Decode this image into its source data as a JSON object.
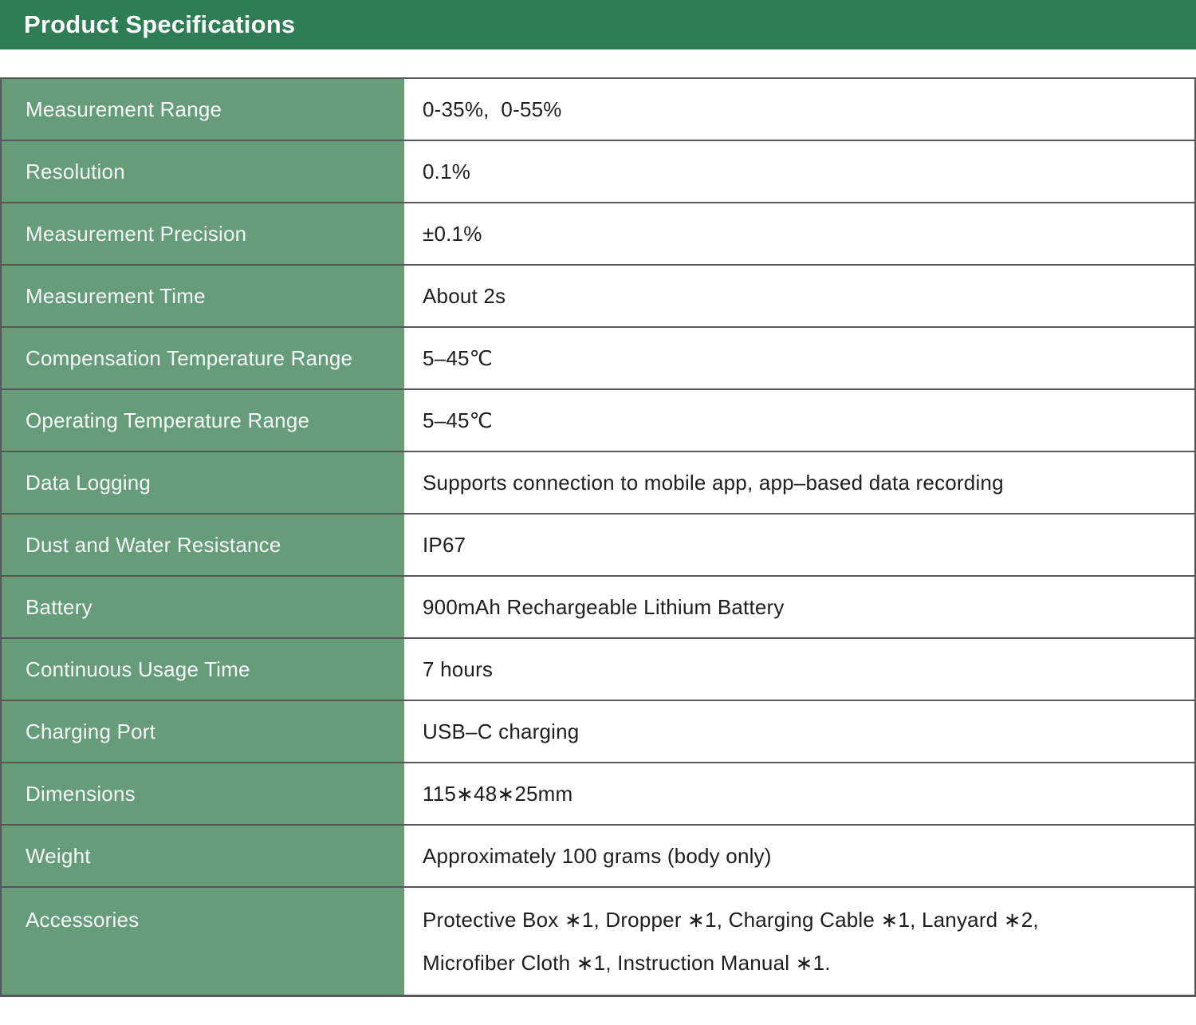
{
  "header": {
    "title": "Product Specifications"
  },
  "colors": {
    "header_green": "#2E7D55",
    "label_green": "#679C7B",
    "border_gray": "#565656",
    "value_text": "#1E1E1E",
    "label_text": "#F4F9F6"
  },
  "table": {
    "rows": [
      {
        "label": "Measurement Range",
        "value": "0-35%,  0-55%"
      },
      {
        "label": "Resolution",
        "value": "0.1%"
      },
      {
        "label": "Measurement Precision",
        "value": "±0.1%"
      },
      {
        "label": "Measurement Time",
        "value": "About 2s"
      },
      {
        "label": "Compensation Temperature Range",
        "value": "5–45℃"
      },
      {
        "label": "Operating Temperature Range",
        "value": "5–45℃"
      },
      {
        "label": "Data Logging",
        "value": "Supports connection to mobile app, app–based data recording"
      },
      {
        "label": "Dust and Water Resistance",
        "value": "IP67"
      },
      {
        "label": "Battery",
        "value": "900mAh Rechargeable Lithium Battery"
      },
      {
        "label": "Continuous Usage Time",
        "value": "7 hours"
      },
      {
        "label": "Charging Port",
        "value": "USB–C charging"
      },
      {
        "label": "Dimensions",
        "value": "115∗48∗25mm"
      },
      {
        "label": "Weight",
        "value": "Approximately 100 grams (body only)"
      },
      {
        "label": "Accessories",
        "value": "Protective Box ∗1, Dropper ∗1, Charging Cable ∗1, Lanyard ∗2,",
        "value2": "Microfiber Cloth ∗1, Instruction Manual ∗1."
      }
    ]
  }
}
